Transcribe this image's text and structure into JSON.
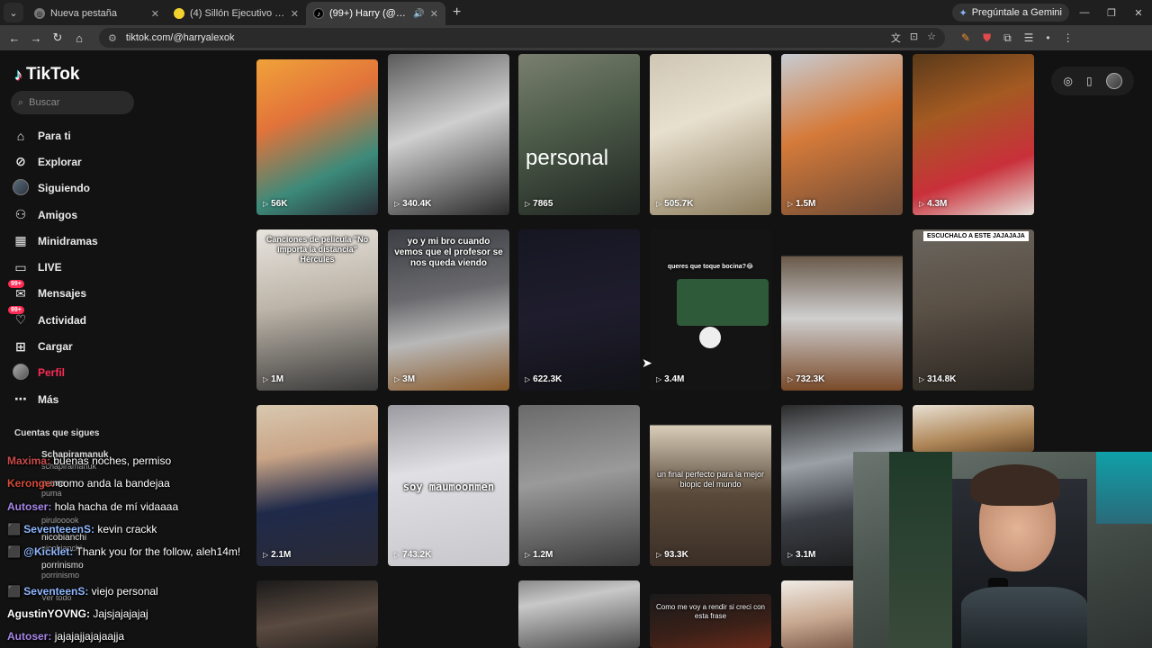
{
  "browser": {
    "tabs": [
      {
        "title": "Nueva pestaña",
        "active": false
      },
      {
        "title": "(4) Sillón Ejecutivo Gerencial Re",
        "active": false
      },
      {
        "title": "(99+) Harry (@harryalexok)",
        "active": true
      }
    ],
    "gemini_label": "Pregúntale a Gemini",
    "url": "tiktok.com/@harryalexok"
  },
  "tiktok": {
    "logo": "TikTok",
    "search_placeholder": "Buscar",
    "menu": [
      {
        "label": "Para ti",
        "icon": "home-icon"
      },
      {
        "label": "Explorar",
        "icon": "compass-icon"
      },
      {
        "label": "Siguiendo",
        "icon": "following-avatar-icon"
      },
      {
        "label": "Amigos",
        "icon": "friends-icon"
      },
      {
        "label": "Minidramas",
        "icon": "film-icon"
      },
      {
        "label": "LIVE",
        "icon": "live-icon"
      },
      {
        "label": "Mensajes",
        "icon": "message-icon",
        "badge": "99+"
      },
      {
        "label": "Actividad",
        "icon": "activity-icon",
        "badge": "99+"
      },
      {
        "label": "Cargar",
        "icon": "upload-icon"
      },
      {
        "label": "Perfil",
        "icon": "profile-avatar-icon"
      },
      {
        "label": "Más",
        "icon": "more-icon"
      }
    ],
    "following_title": "Cuentas que sigues",
    "following_ghost": [
      "Schapiramanuk",
      "schapiramanuk",
      "puma",
      "puma",
      "pirulooook",
      "nicobianchi",
      "nicobianchi",
      "porrinismo",
      "porrinismo",
      "Ver todo"
    ],
    "videos": [
      {
        "views": "56K",
        "caption": ""
      },
      {
        "views": "340.4K",
        "caption": ""
      },
      {
        "views": "7865",
        "caption": "personal"
      },
      {
        "views": "505.7K",
        "caption": ""
      },
      {
        "views": "1.5M",
        "caption": ""
      },
      {
        "views": "4.3M",
        "caption": ""
      },
      {
        "views": "1M",
        "caption": "Canciones de película \"No importa la distancia\" Hércules"
      },
      {
        "views": "3M",
        "caption": "yo y mi bro cuando vemos que el profesor se nos queda viendo"
      },
      {
        "views": "622.3K",
        "caption": ""
      },
      {
        "views": "3.4M",
        "caption": "queres que toque bocina?😂"
      },
      {
        "views": "732.3K",
        "caption": ""
      },
      {
        "views": "314.8K",
        "caption": "ESCUCHALO A ESTE JAJAJAJA"
      },
      {
        "views": "2.1M",
        "caption": ""
      },
      {
        "views": "743.2K",
        "caption": "soy maumoonmen"
      },
      {
        "views": "1.2M",
        "caption": ""
      },
      {
        "views": "93.3K",
        "caption": "un final perfecto para la mejor biopic del mundo"
      },
      {
        "views": "3.1M",
        "caption": ""
      },
      {
        "views": "",
        "caption": ""
      },
      {
        "views": "",
        "caption": ""
      },
      {
        "views": "",
        "caption": ""
      },
      {
        "views": "",
        "caption": ""
      },
      {
        "views": "",
        "caption": "Como me voy a rendir si creci con esta frase"
      },
      {
        "views": "",
        "caption": ""
      }
    ]
  },
  "chat": [
    {
      "user": "Maxima:",
      "text": "buenas noches, permiso",
      "color": "#c84a4a"
    },
    {
      "user": "Keronge:",
      "text": "como anda la bandejaa",
      "color": "#d44a3a"
    },
    {
      "user": "Autoser:",
      "text": "hola hacha de mí vidaaaa",
      "color": "#a786e8"
    },
    {
      "user": "SeventeeenS:",
      "text": "kevin crackk",
      "color": "#8fb7ff"
    },
    {
      "user": "@Kicklet:",
      "text": "Thank you for the follow, aleh14m!",
      "color": "#8fb7ff"
    },
    {
      "user": "SeventeenS:",
      "text": "viejo personal",
      "color": "#8fb7ff"
    },
    {
      "user": "AgustinYOVNG:",
      "text": "Jajsjajajajaj",
      "color": "#ffffff"
    },
    {
      "user": "Autoser:",
      "text": "jajajajjajajaajja",
      "color": "#a786e8"
    }
  ]
}
